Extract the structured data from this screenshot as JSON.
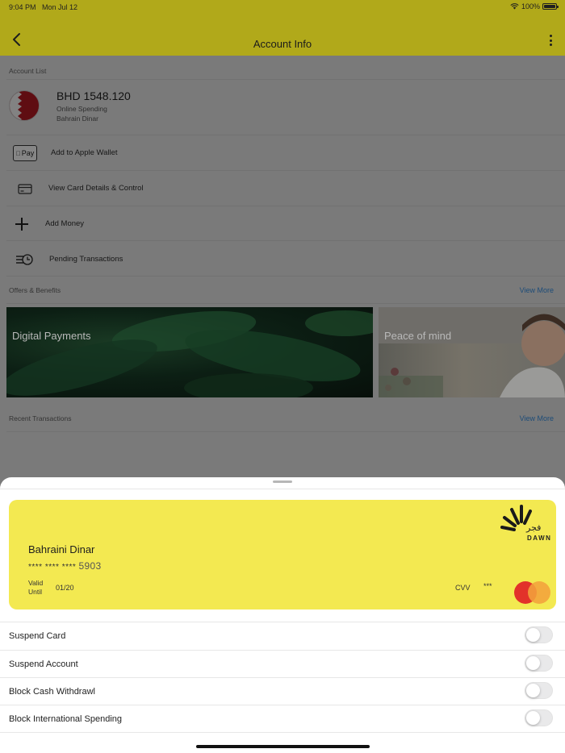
{
  "status_bar": {
    "time": "9:04 PM",
    "date": "Mon Jul 12",
    "battery": "100%"
  },
  "header": {
    "title": "Account Info",
    "back_icon": "chevron-left-icon",
    "more_icon": "more-vertical-icon"
  },
  "account_list": {
    "label": "Account List",
    "account": {
      "balance": "BHD 1548.120",
      "type": "Online Spending",
      "currency": "Bahrain Dinar",
      "flag_icon": "bahrain-flag-icon"
    }
  },
  "actions": [
    {
      "label": "Add to Apple Wallet",
      "icon": "apple-pay-icon",
      "icon_text": "Pay"
    },
    {
      "label": "View Card Details & Control",
      "icon": "credit-card-icon"
    },
    {
      "label": "Add Money",
      "icon": "plus-icon"
    },
    {
      "label": "Pending Transactions",
      "icon": "pending-clock-icon"
    }
  ],
  "offers": {
    "label": "Offers & Benefits",
    "view_more": "View More",
    "items": [
      {
        "caption": "Digital Payments"
      },
      {
        "caption": "Peace of mind"
      }
    ]
  },
  "recent": {
    "label": "Recent Transactions",
    "view_more": "View More"
  },
  "card": {
    "name": "Bahraini Dinar",
    "masked": "**** **** ****",
    "last4": "5903",
    "valid_line1": "Valid",
    "valid_line2": "Until",
    "expiry": "01/20",
    "cvv_label": "CVV",
    "cvv_value": "***",
    "brand_arabic": "فجر",
    "brand_latin": "DAWN",
    "network_icon": "mastercard-icon"
  },
  "toggles": [
    {
      "label": "Suspend Card",
      "on": false
    },
    {
      "label": "Suspend Account",
      "on": false
    },
    {
      "label": "Block Cash Withdrawl",
      "on": false
    },
    {
      "label": "Block International Spending",
      "on": false
    }
  ],
  "colors": {
    "header": "#b1a91a",
    "card": "#f3e951",
    "link": "#1d4c78",
    "overlay": "#7a7a7a"
  }
}
